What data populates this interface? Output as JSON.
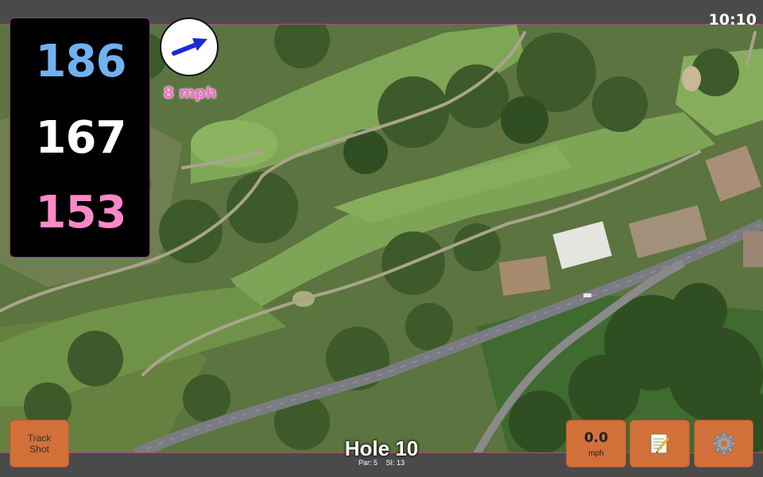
{
  "status": {
    "clock": "10:10"
  },
  "distances": {
    "back": "186",
    "middle": "167",
    "front": "153"
  },
  "wind": {
    "speed_label": "8 mph",
    "direction_icon": "arrow-icon"
  },
  "hole": {
    "title": "Hole 10",
    "par_label": "Par: 5",
    "si_label": "SI: 13"
  },
  "buttons": {
    "track_shot_line1": "Track",
    "track_shot_line2": "Shot",
    "speed_value": "0.0",
    "speed_unit": "mph",
    "notes_icon": "notepad-icon",
    "settings_icon": "gear-icon"
  },
  "colors": {
    "back_distance": "#6fb2f0",
    "middle_distance": "#ffffff",
    "front_distance": "#ff88c8",
    "wind_label": "#ff66cc",
    "button": "#d2703a",
    "bar": "#4a4a4a"
  }
}
